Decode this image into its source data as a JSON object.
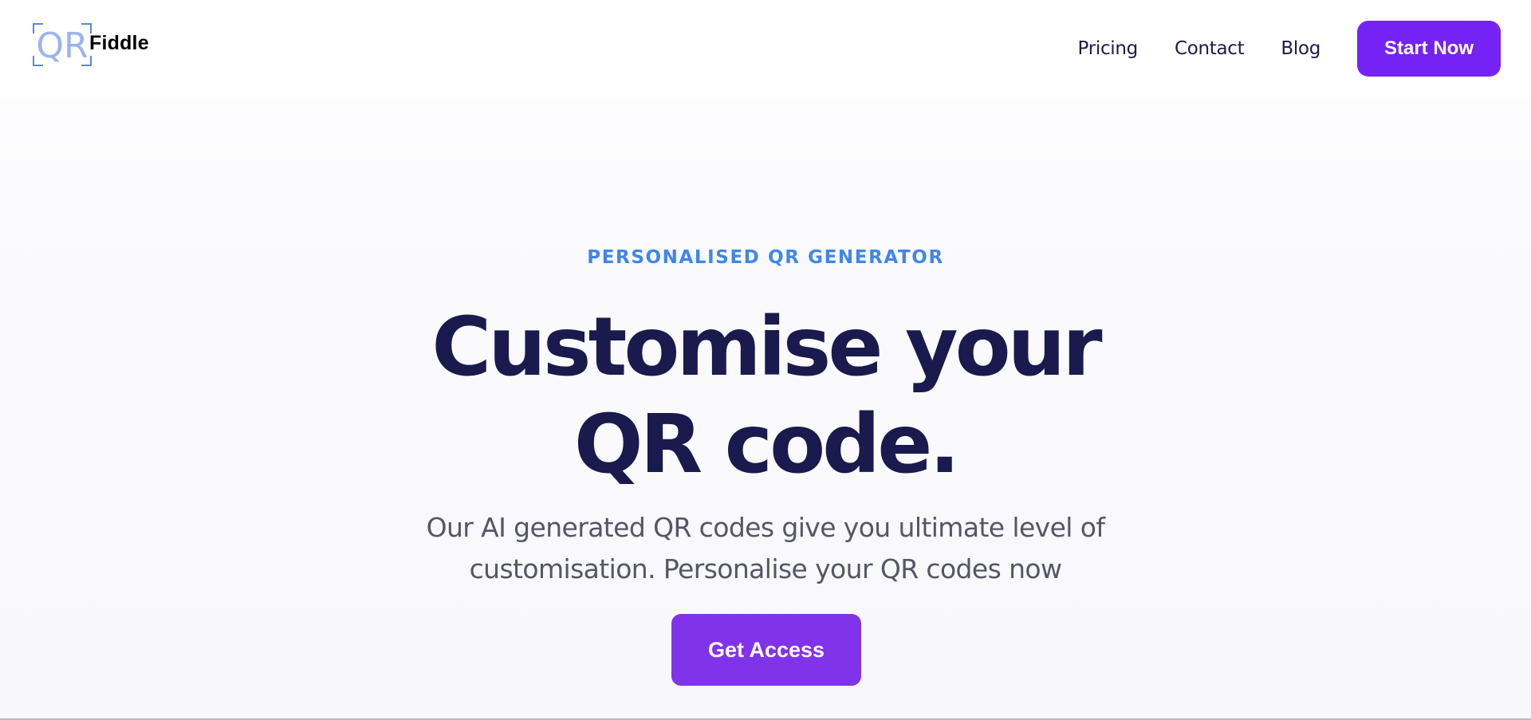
{
  "brand": {
    "logo_mark": "QR",
    "name": "Fiddle",
    "logo_color": "#9bb4ee"
  },
  "nav": {
    "links": [
      "Pricing",
      "Contact",
      "Blog"
    ],
    "cta_label": "Start Now"
  },
  "hero": {
    "eyebrow": "PERSONALISED QR GENERATOR",
    "headline": "Customise your QR code.",
    "subtext": "Our AI generated QR codes give you ultimate level of customisation. Personalise your QR codes now",
    "cta_label": "Get Access"
  },
  "colors": {
    "accent": "#7522f5",
    "cta_secondary": "#8133ea",
    "eyebrow": "#3f86ea",
    "headline": "#1a1a4e",
    "body_text": "#545669"
  }
}
